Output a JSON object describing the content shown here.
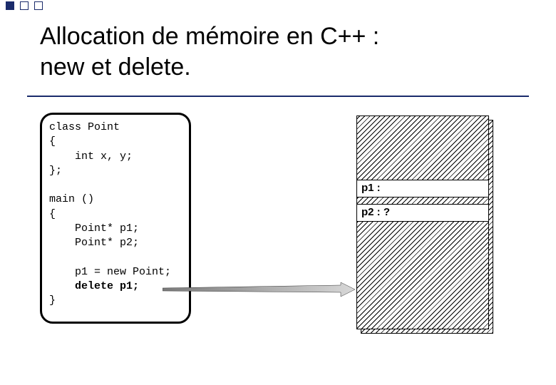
{
  "title_line1": "Allocation de mémoire en C++ :",
  "title_line2": "new et delete.",
  "code": {
    "line1": "class Point",
    "line2": "{",
    "line3": "    int x, y;",
    "line4": "};",
    "line5": "",
    "line6": "main ()",
    "line7": "{",
    "line8": "    Point* p1;",
    "line9": "    Point* p2;",
    "line10": "",
    "line11": "    p1 = new Point;",
    "line12_pre": "    ",
    "line12_kw": "delete p1;",
    "line13": "}"
  },
  "mem": {
    "p1_label": "p1 :",
    "p2_label": "p2 : ?"
  }
}
